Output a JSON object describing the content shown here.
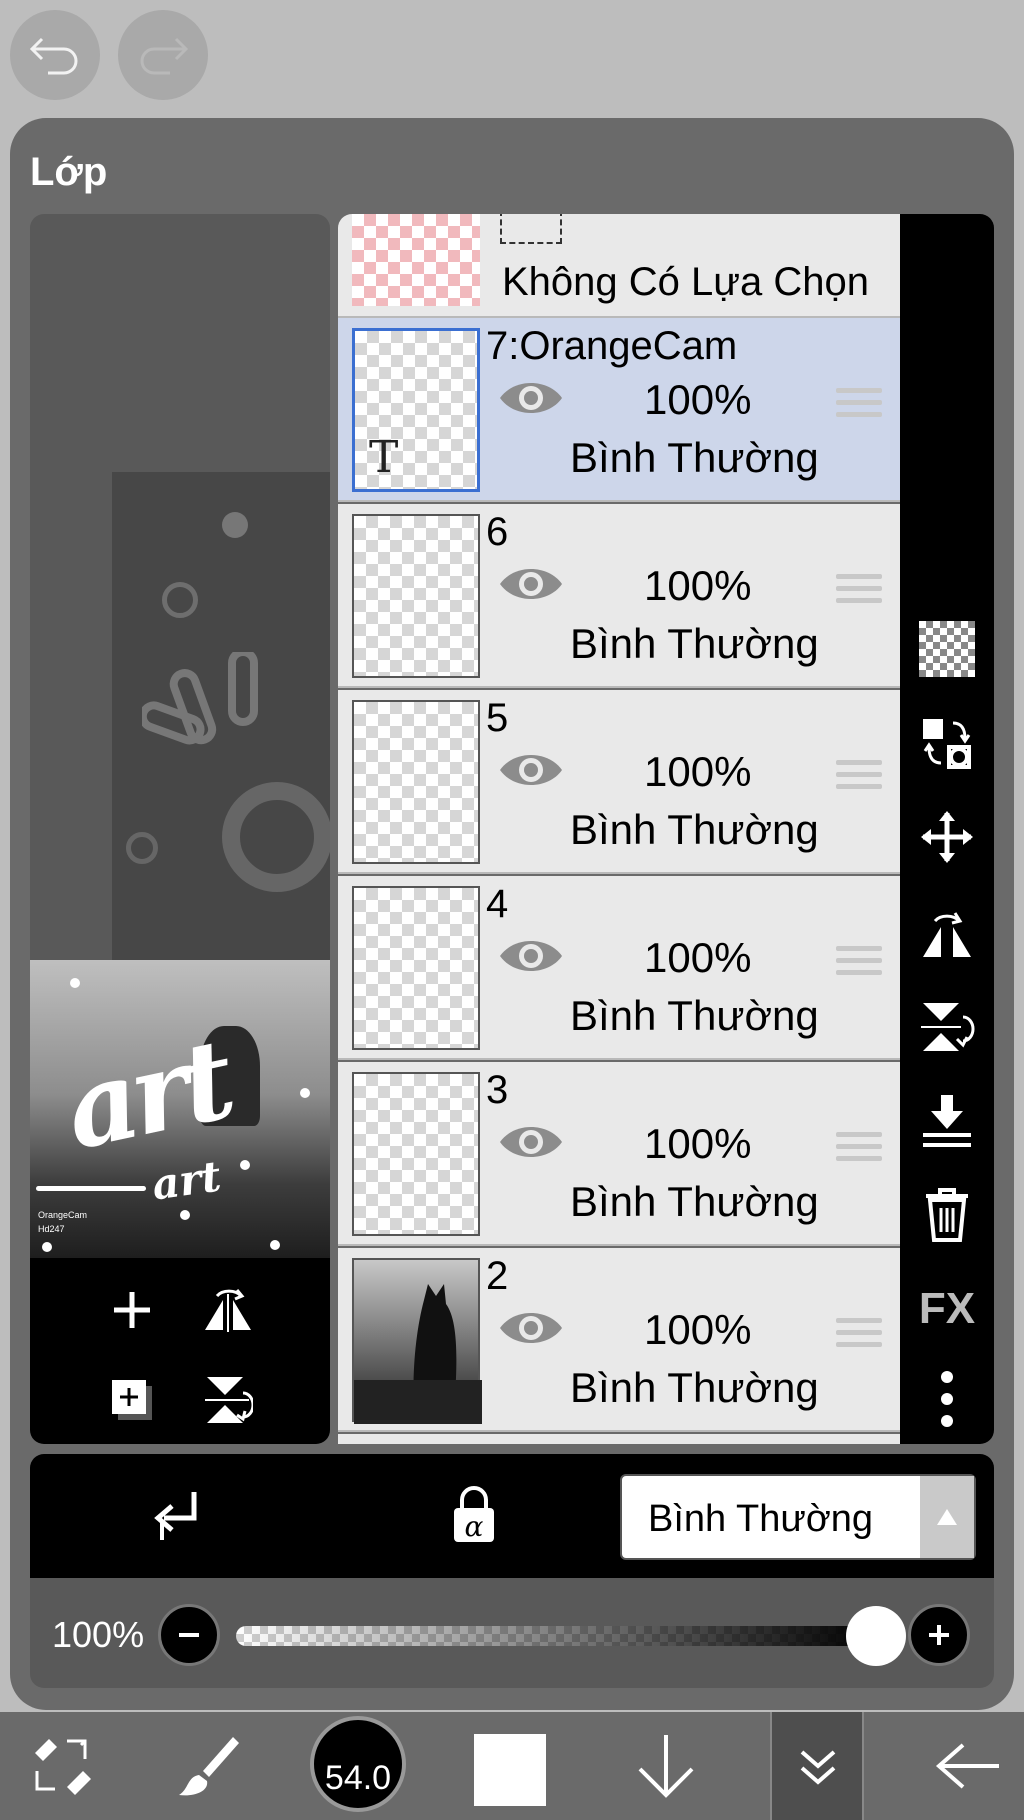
{
  "panel": {
    "title": "Lớp"
  },
  "top_buttons": {
    "undo_icon": "undo-icon",
    "redo_icon": "redo-icon"
  },
  "selection_layer": {
    "label": "Không Có Lựa Chọn"
  },
  "layers": [
    {
      "name": "7:OrangeCam",
      "opacity": "100%",
      "blend": "Bình Thường",
      "type": "text",
      "selected": true
    },
    {
      "name": "6",
      "opacity": "100%",
      "blend": "Bình Thường",
      "type": "raster",
      "selected": false
    },
    {
      "name": "5",
      "opacity": "100%",
      "blend": "Bình Thường",
      "type": "raster",
      "selected": false
    },
    {
      "name": "4",
      "opacity": "100%",
      "blend": "Bình Thường",
      "type": "raster",
      "selected": false
    },
    {
      "name": "3",
      "opacity": "100%",
      "blend": "Bình Thường",
      "type": "raster",
      "selected": false
    },
    {
      "name": "2",
      "opacity": "100%",
      "blend": "Bình Thường",
      "type": "photo",
      "selected": false
    }
  ],
  "text_layer_marker": "T",
  "thumbnail": {
    "art_big": "art",
    "art_small": "art",
    "caption1": "OrangeCam",
    "caption2": "Hd247"
  },
  "right_tools": {
    "fx_label": "FX"
  },
  "blend_bar": {
    "current_blend": "Bình Thường"
  },
  "opacity": {
    "label": "100%",
    "value_percent": 100
  },
  "bottom_bar": {
    "brush_size": "54.0",
    "color": "#ffffff"
  }
}
